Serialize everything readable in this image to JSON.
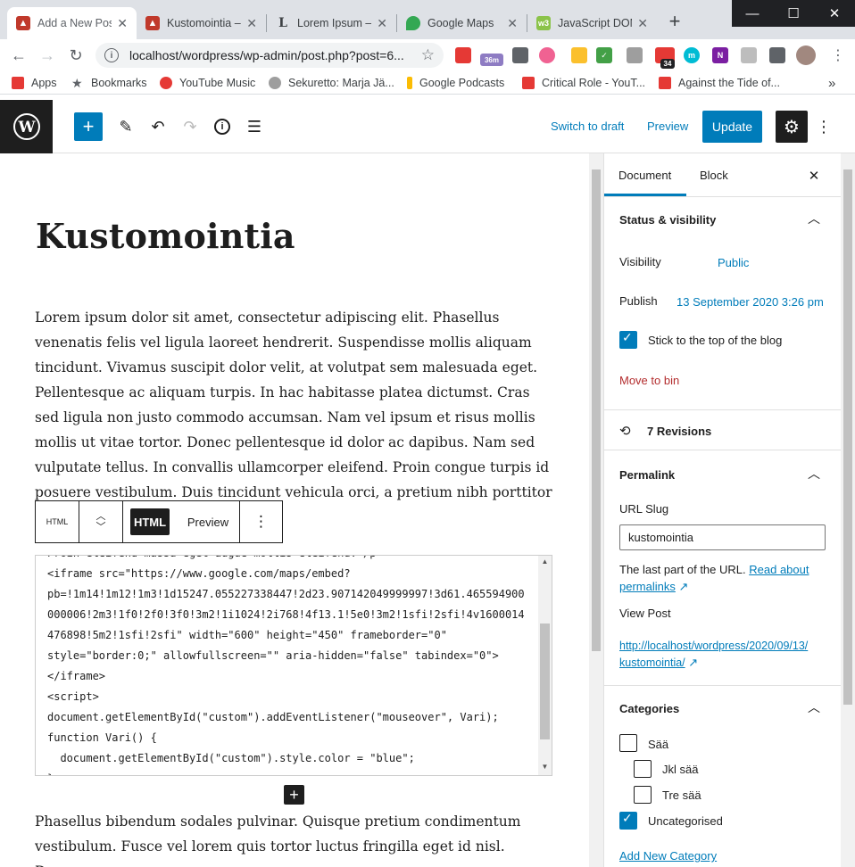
{
  "browser": {
    "tabs": [
      {
        "title": "Add a New Pos",
        "active": true
      },
      {
        "title": "Kustomointia –"
      },
      {
        "title": "Lorem Ipsum –"
      },
      {
        "title": "Google Maps"
      },
      {
        "title": "JavaScript DOM"
      }
    ],
    "new_tab": "+",
    "window": {
      "minimize": "—",
      "maximize": "☐",
      "close": "✕"
    },
    "url": "localhost/wordpress/wp-admin/post.php?post=6...",
    "extension_badges": {
      "timer": "36m",
      "calendar": "34"
    },
    "bookmarks": [
      "Apps",
      "Bookmarks",
      "YouTube Music",
      "Sekuretto: Marja Jä...",
      "Google Podcasts",
      "Critical Role - YouT...",
      "Against the Tide of..."
    ],
    "more_bookmarks": "»"
  },
  "wp_toolbar": {
    "switch_to_draft": "Switch to draft",
    "preview": "Preview",
    "update": "Update"
  },
  "post": {
    "title": "Kustomointia",
    "paragraph1": "Lorem ipsum dolor sit amet, consectetur adipiscing elit. Phasellus venenatis felis vel ligula laoreet hendrerit. Suspendisse mollis aliquam tincidunt. Vivamus suscipit dolor velit, at volutpat sem malesuada eget. Pellentesque ac aliquam turpis. In hac habitasse platea dictumst. Cras sed ligula non justo commodo accumsan. Nam vel ipsum et risus mollis mollis ut vitae tortor. Donec pellentesque id dolor ac dapibus. Nam sed vulputate tellus. In convallis ullamcorper eleifend. Proin congue turpis id posuere vestibulum. Duis tincidunt vehicula orci, a pretium nibh porttitor nec. Ut id convallis",
    "paragraph2": "Phasellus bibendum sodales pulvinar. Quisque pretium condimentum vestibulum. Fusce vel lorem quis tortor luctus fringilla eget id nisl. Donec",
    "block_toolbar": {
      "type": "HTML",
      "html_tab": "HTML",
      "preview_tab": "Preview"
    },
    "code_lines": [
      "Proin eleifend massa eget augue mollis eleifend.</p>",
      "<iframe src=\"https://www.google.com/maps/embed?",
      "pb=!1m14!1m12!1m3!1d15247.055227338447!2d23.907142049999997!3d61.465594900",
      "000006!2m3!1f0!2f0!3f0!3m2!1i1024!2i768!4f13.1!5e0!3m2!1sfi!2sfi!4v1600014",
      "476898!5m2!1sfi!2sfi\" width=\"600\" height=\"450\" frameborder=\"0\"",
      "style=\"border:0;\" allowfullscreen=\"\" aria-hidden=\"false\" tabindex=\"0\">",
      "</iframe>",
      "<script>",
      "document.getElementById(\"custom\").addEventListener(\"mouseover\", Vari);",
      "function Vari() {",
      "  document.getElementById(\"custom\").style.color = \"blue\";",
      "}"
    ]
  },
  "sidebar": {
    "tabs": {
      "document": "Document",
      "block": "Block"
    },
    "status": {
      "heading": "Status & visibility",
      "visibility_label": "Visibility",
      "visibility_value": "Public",
      "publish_label": "Publish",
      "publish_value": "13 September 2020 3:26 pm",
      "sticky_label": "Stick to the top of the blog",
      "sticky_checked": true,
      "move_to_bin": "Move to bin"
    },
    "revisions": "7 Revisions",
    "permalink": {
      "heading": "Permalink",
      "slug_label": "URL Slug",
      "slug_value": "kustomointia",
      "help_text": "The last part of the URL.",
      "help_link": "Read about permalinks",
      "view_post_label": "View Post",
      "view_post_url_line1": "http://localhost/wordpress/2020/09/13/",
      "view_post_url_line2": "kustomointia/"
    },
    "categories": {
      "heading": "Categories",
      "items": [
        {
          "label": "Sää",
          "checked": false,
          "level": 0
        },
        {
          "label": "Jkl sää",
          "checked": false,
          "level": 1
        },
        {
          "label": "Tre sää",
          "checked": false,
          "level": 1
        },
        {
          "label": "Uncategorised",
          "checked": true,
          "level": 0
        }
      ],
      "add_new": "Add New Category"
    }
  },
  "colors": {
    "wp_blue": "#007cba",
    "dark": "#1e1e1e",
    "bin_red": "#b32d2e",
    "chrome_tabbar": "#dee1e6"
  }
}
